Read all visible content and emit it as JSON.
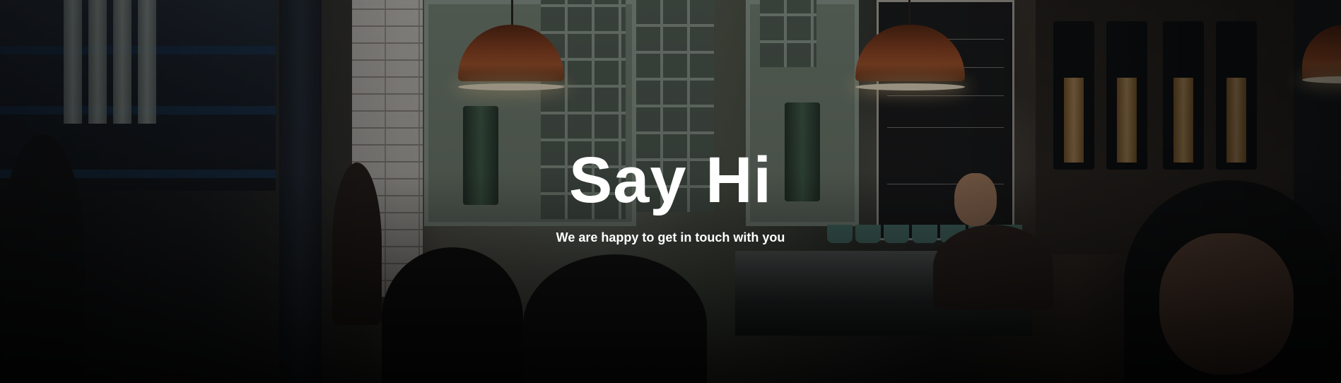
{
  "hero": {
    "title": "Say Hi",
    "subtitle": "We are happy to get in touch with you",
    "background_description": "cafe-interior-photo",
    "text_color": "#ffffff",
    "overlay_color": "#000000"
  }
}
